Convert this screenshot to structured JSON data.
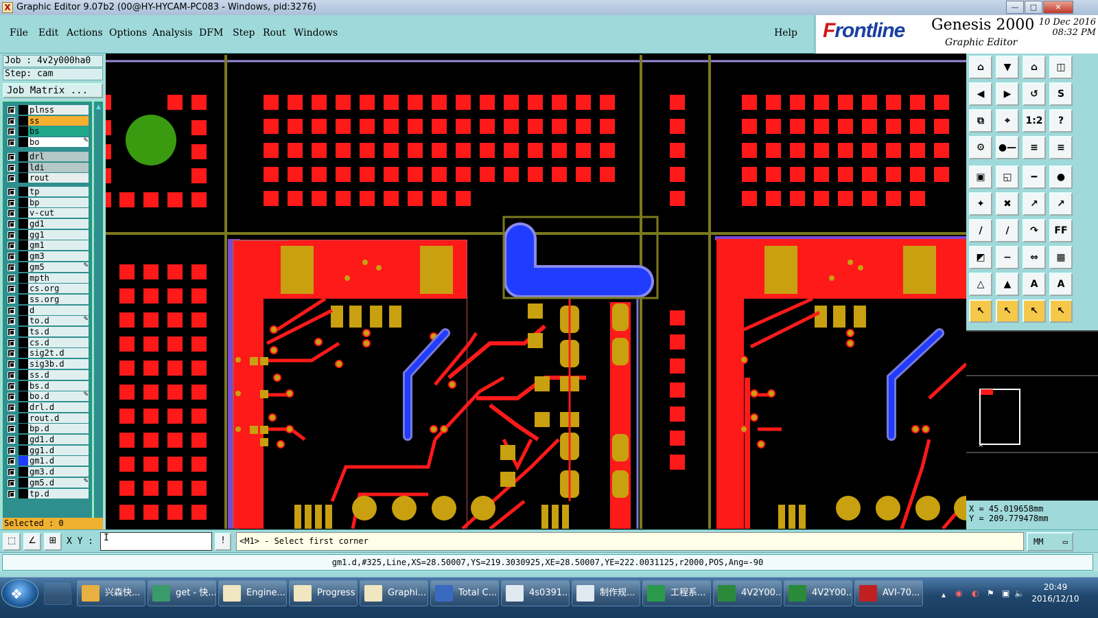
{
  "window": {
    "title": "Graphic Editor 9.07b2 (00@HY-HYCAM-PC083 - Windows, pid:3276)",
    "controls": [
      "—",
      "□",
      "✕"
    ]
  },
  "menu": {
    "items": [
      "File",
      "Edit",
      "Actions",
      "Options",
      "Analysis",
      "DFM",
      "Step",
      "Rout",
      "Windows"
    ],
    "help": "Help"
  },
  "logo": {
    "brand_a": "F",
    "brand_b": "rontline",
    "product": "Genesis 2000",
    "subtitle": "Graphic Editor",
    "date": "10 Dec 2016",
    "time": "08:32 PM"
  },
  "job": {
    "job_label": "Job : 4v2y000ha0",
    "step_label": "Step: cam",
    "matrix_button": "Job Matrix ...",
    "selected": "Selected : 0"
  },
  "layers": [
    {
      "name": "plnss",
      "color": "#e6eeee",
      "swatch": "#000000"
    },
    {
      "name": "ss",
      "color": "#f5b030",
      "swatch": "#000000"
    },
    {
      "name": "bs",
      "color": "#20a88a",
      "swatch": "#000000"
    },
    {
      "name": "bo",
      "color": "#ffffff",
      "swatch": "#000000",
      "edit": "✎"
    },
    {
      "name": "drl",
      "color": "#b4c8c8",
      "swatch": "#000000"
    },
    {
      "name": "ldi",
      "color": "#b4c8c8",
      "swatch": "#000000"
    },
    {
      "name": "rout",
      "color": "#e6eeee",
      "swatch": "#000000"
    },
    {
      "name": "tp",
      "color": "#dfeff0",
      "swatch": "#000000"
    },
    {
      "name": "bp",
      "color": "#dfeff0",
      "swatch": "#000000"
    },
    {
      "name": "v-cut",
      "color": "#dfeff0",
      "swatch": "#000000"
    },
    {
      "name": "gd1",
      "color": "#dfeff0",
      "swatch": "#000000"
    },
    {
      "name": "gg1",
      "color": "#dfeff0",
      "swatch": "#000000"
    },
    {
      "name": "gm1",
      "color": "#dfeff0",
      "swatch": "#000000"
    },
    {
      "name": "gm3",
      "color": "#dfeff0",
      "swatch": "#000000"
    },
    {
      "name": "gm5",
      "color": "#dfeff0",
      "swatch": "#000000",
      "edit": "✎"
    },
    {
      "name": "mpth",
      "color": "#dfeff0",
      "swatch": "#000000"
    },
    {
      "name": "cs.org",
      "color": "#dfeff0",
      "swatch": "#000000"
    },
    {
      "name": "ss.org",
      "color": "#dfeff0",
      "swatch": "#000000"
    },
    {
      "name": "d",
      "color": "#dfeff0",
      "swatch": "#000000"
    },
    {
      "name": "to.d",
      "color": "#dfeff0",
      "swatch": "#000000",
      "edit": "✎"
    },
    {
      "name": "ts.d",
      "color": "#dfeff0",
      "swatch": "#000000"
    },
    {
      "name": "cs.d",
      "color": "#dfeff0",
      "swatch": "#000000"
    },
    {
      "name": "sig2t.d",
      "color": "#dfeff0",
      "swatch": "#000000"
    },
    {
      "name": "sig3b.d",
      "color": "#dfeff0",
      "swatch": "#000000"
    },
    {
      "name": "ss.d",
      "color": "#dfeff0",
      "swatch": "#000000"
    },
    {
      "name": "bs.d",
      "color": "#dfeff0",
      "swatch": "#000000"
    },
    {
      "name": "bo.d",
      "color": "#dfeff0",
      "swatch": "#000000",
      "edit": "✎"
    },
    {
      "name": "drl.d",
      "color": "#dfeff0",
      "swatch": "#000000"
    },
    {
      "name": "rout.d",
      "color": "#dfeff0",
      "swatch": "#000000"
    },
    {
      "name": "bp.d",
      "color": "#dfeff0",
      "swatch": "#000000"
    },
    {
      "name": "gd1.d",
      "color": "#dfeff0",
      "swatch": "#000000"
    },
    {
      "name": "gg1.d",
      "color": "#dfeff0",
      "swatch": "#000000"
    },
    {
      "name": "gm1.d",
      "color": "#dfeff0",
      "swatch": "#1f3cff"
    },
    {
      "name": "gm3.d",
      "color": "#dfeff0",
      "swatch": "#000000"
    },
    {
      "name": "gm5.d",
      "color": "#dfeff0",
      "swatch": "#000000",
      "edit": "✎"
    },
    {
      "name": "tp.d",
      "color": "#dfeff0",
      "swatch": "#000000"
    }
  ],
  "tools": [
    {
      "icon": "zoom-home-icon",
      "glyph": "⌂"
    },
    {
      "icon": "pan-down-icon",
      "glyph": "▼"
    },
    {
      "icon": "home-icon",
      "glyph": "⌂"
    },
    {
      "icon": "window-split-icon",
      "glyph": "◫"
    },
    {
      "icon": "pan-left-icon",
      "glyph": "◀"
    },
    {
      "icon": "pan-right-icon",
      "glyph": "▶"
    },
    {
      "icon": "rotate-icon",
      "glyph": "↺"
    },
    {
      "icon": "mirror-icon",
      "glyph": "S"
    },
    {
      "icon": "fit-screen-icon",
      "glyph": "⧉"
    },
    {
      "icon": "center-icon",
      "glyph": "⌖"
    },
    {
      "icon": "scale-icon",
      "glyph": "1:2"
    },
    {
      "icon": "help-icon",
      "glyph": "?"
    },
    {
      "icon": "measure-icon",
      "glyph": "⚙"
    },
    {
      "icon": "line-measure-icon",
      "glyph": "●—"
    },
    {
      "icon": "net-icon",
      "glyph": "≡"
    },
    {
      "icon": "net2-icon",
      "glyph": "≡"
    },
    {
      "icon": "pad-icon",
      "glyph": "▣"
    },
    {
      "icon": "outline-icon",
      "glyph": "◱"
    },
    {
      "icon": "ruler-icon",
      "glyph": "━"
    },
    {
      "icon": "dot-icon",
      "glyph": "●"
    },
    {
      "icon": "connect-icon",
      "glyph": "✦"
    },
    {
      "icon": "cross-icon",
      "glyph": "✖"
    },
    {
      "icon": "snap-icon",
      "glyph": "↗"
    },
    {
      "icon": "snap2-icon",
      "glyph": "↗"
    },
    {
      "icon": "edit-line-icon",
      "glyph": "∕"
    },
    {
      "icon": "draw-line-icon",
      "glyph": "∕"
    },
    {
      "icon": "arc-icon",
      "glyph": "↷"
    },
    {
      "icon": "fab-icon",
      "glyph": "FF"
    },
    {
      "icon": "copy-pad-icon",
      "glyph": "◩"
    },
    {
      "icon": "minus-icon",
      "glyph": "−"
    },
    {
      "icon": "resize-icon",
      "glyph": "⇔"
    },
    {
      "icon": "group-icon",
      "glyph": "▦"
    },
    {
      "icon": "triangle-icon",
      "glyph": "△"
    },
    {
      "icon": "triangle2-icon",
      "glyph": "▲"
    },
    {
      "icon": "letter-a-icon",
      "glyph": "A"
    },
    {
      "icon": "letter-a2-icon",
      "glyph": "A"
    },
    {
      "icon": "pointer-icon",
      "glyph": "↖",
      "selected": true
    },
    {
      "icon": "pointer-box-icon",
      "glyph": "↖",
      "selected": true
    },
    {
      "icon": "pointer-select-icon",
      "glyph": "↖",
      "selected": true
    },
    {
      "icon": "pointer-multi-icon",
      "glyph": "↖",
      "selected": true
    }
  ],
  "coords": {
    "x": "X = 45.019658mm",
    "y": "Y = 209.779478mm"
  },
  "command": {
    "xy_label": "X Y :",
    "input_value": "I",
    "bang": "!",
    "prompt": "<M1> - Select first corner",
    "units": "MM"
  },
  "status": "gm1.d,#325,Line,XS=28.50007,YS=219.3030925,XE=28.50007,YE=222.0031125,r2000,POS,Ang=-90",
  "taskbar": {
    "tasks": [
      {
        "label": "兴森快...",
        "icon_color": "#e8b040"
      },
      {
        "label": "get - 快...",
        "icon_color": "#3a9a6a"
      },
      {
        "label": "Engine...",
        "icon_color": "#f0e6c0"
      },
      {
        "label": "Progress",
        "icon_color": "#f0e6c0"
      },
      {
        "label": "Graphi...",
        "icon_color": "#f0e6c0"
      },
      {
        "label": "Total C...",
        "icon_color": "#3a6ac0"
      },
      {
        "label": "4s0391...",
        "icon_color": "#e0e8f0"
      },
      {
        "label": "制作规...",
        "icon_color": "#e0e8f0"
      },
      {
        "label": "工程系...",
        "icon_color": "#2a9a4a"
      },
      {
        "label": "4V2Y00...",
        "icon_color": "#2a8a3a"
      },
      {
        "label": "4V2Y00...",
        "icon_color": "#2a8a3a"
      },
      {
        "label": "AVI-70...",
        "icon_color": "#c02020"
      }
    ],
    "time": "20:49",
    "date": "2016/12/10"
  }
}
